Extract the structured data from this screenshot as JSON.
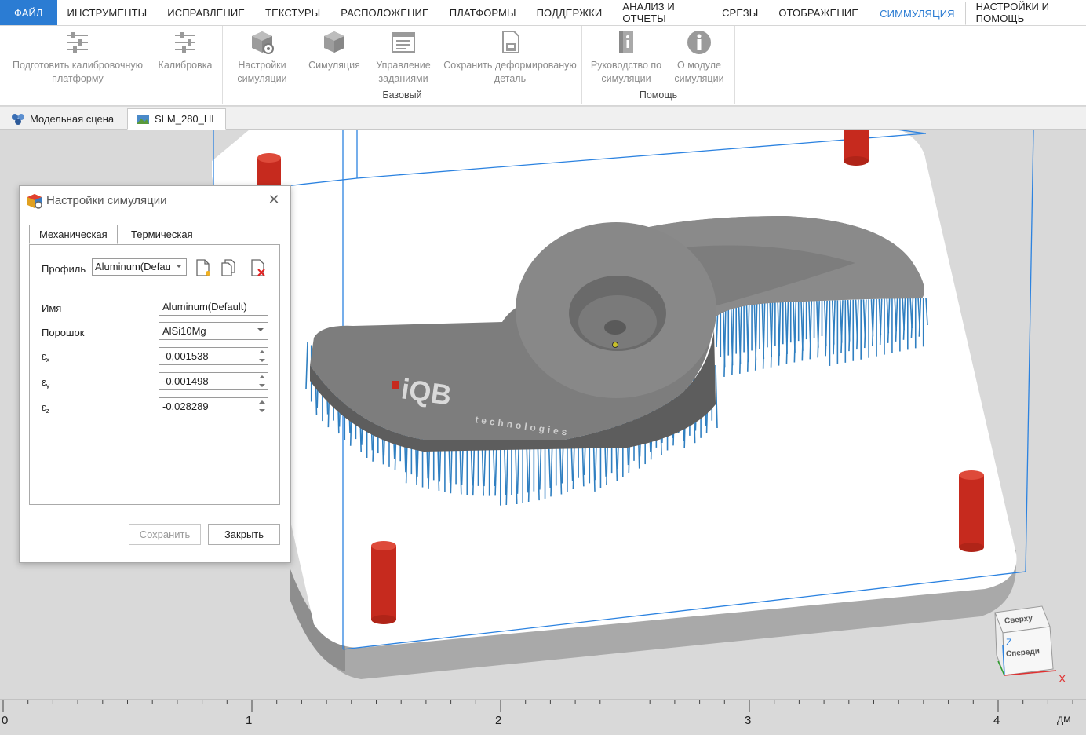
{
  "menu": {
    "items": [
      "ФАЙЛ",
      "ИНСТРУМЕНТЫ",
      "ИСПРАВЛЕНИЕ",
      "ТЕКСТУРЫ",
      "РАСПОЛОЖЕНИЕ",
      "ПЛАТФОРМЫ",
      "ПОДДЕРЖКИ",
      "АНАЛИЗ И ОТЧЕТЫ",
      "СРЕЗЫ",
      "ОТОБРАЖЕНИЕ",
      "СИММУЛЯЦИЯ",
      "НАСТРОЙКИ И ПОМОЩЬ"
    ],
    "active": "СИММУЛЯЦИЯ"
  },
  "ribbon": {
    "calib_prepare": "Подготовить калибровочную платформу",
    "calibration": "Калибровка",
    "sim_settings": "Настройки симуляции",
    "simulation": "Симуляция",
    "job_management": "Управление заданиями",
    "save_deformed": "Сохранить деформированую деталь",
    "group_basic": "Базовый",
    "sim_guide": "Руководство по симуляции",
    "about_module": "О модуле симуляции",
    "group_help": "Помощь"
  },
  "doctabs": {
    "model_scene": "Модельная сцена",
    "platform": "SLM_280_HL"
  },
  "dialog": {
    "title": "Настройки симуляции",
    "tab_mechanical": "Механическая",
    "tab_thermal": "Термическая",
    "profile_label": "Профиль",
    "profile_value": "Aluminum(Defau",
    "name_label": "Имя",
    "name_value": "Aluminum(Default)",
    "powder_label": "Порошок",
    "powder_value": "AlSi10Mg",
    "ex_label": "ε",
    "ex_sub": "x",
    "ex_value": "-0,001538",
    "ey_label": "ε",
    "ey_sub": "y",
    "ey_value": "-0,001498",
    "ez_label": "ε",
    "ez_sub": "z",
    "ez_value": "-0,028289",
    "save_button": "Сохранить",
    "close_button": "Закрыть"
  },
  "viewport": {
    "logo_text": "iQB",
    "logo_sub": "technologies",
    "navcube_top": "Сверху",
    "navcube_front": "Спереди",
    "axis_z": "Z",
    "axis_x": "X",
    "ruler": [
      "0",
      "1",
      "2",
      "3",
      "4"
    ],
    "ruler_unit": "дм"
  },
  "colors": {
    "accent": "#2b7cd3",
    "support": "#2f7fc1",
    "pin": "#c62a1e",
    "part": "#7d7d7d"
  }
}
